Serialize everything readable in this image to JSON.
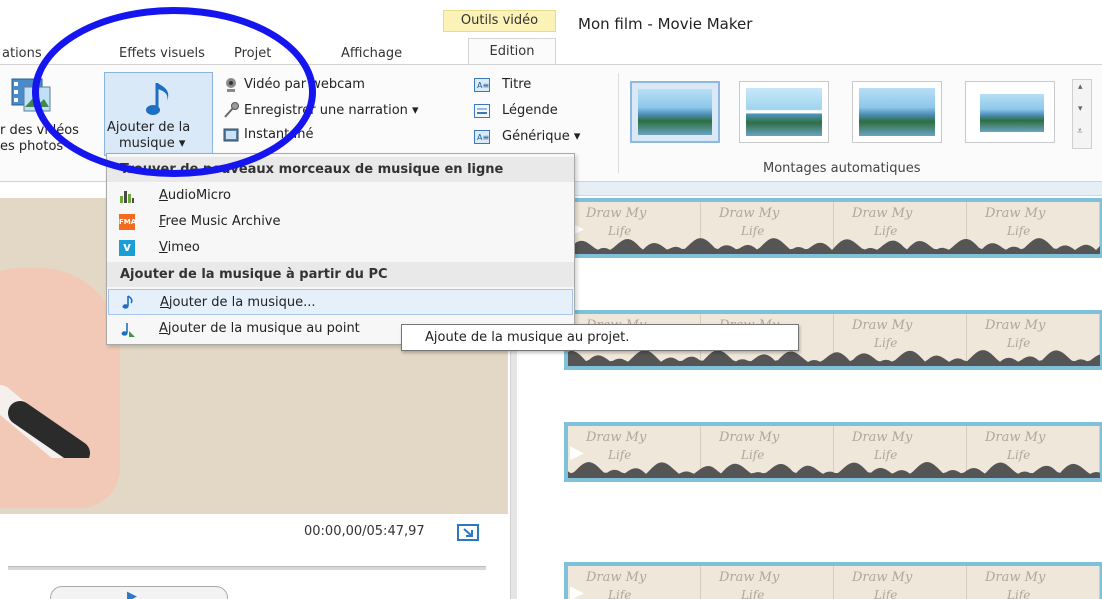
{
  "window": {
    "title": "Mon film - Movie Maker"
  },
  "tabs": {
    "animations": "ations",
    "visual_effects": "Effets visuels",
    "project": "Projet",
    "view": "Affichage",
    "context_group": "Outils vidéo",
    "edit": "Edition"
  },
  "ribbon": {
    "add_videos_line1": "r des vidéos",
    "add_videos_line2": "es photos",
    "add_music_line1": "Ajouter de la",
    "add_music_line2": "musique ▾",
    "webcam": "Vidéo par webcam",
    "narration": "Enregistrer une narration ▾",
    "snapshot": "Instantané",
    "title": "Titre",
    "caption": "Légende",
    "credits": "Générique ▾",
    "automovie_group": "Montages automatiques"
  },
  "menu": {
    "online_header": "Trouver de nouveaux morceaux de musique en ligne",
    "online_items": [
      {
        "label": "AudioMicro",
        "icon": "audiomicro-icon"
      },
      {
        "label": "Free Music Archive",
        "icon": "fma-icon"
      },
      {
        "label": "Vimeo",
        "icon": "vimeo-icon"
      }
    ],
    "pc_header": "Ajouter de la musique à partir du PC",
    "pc_items": [
      {
        "label": "Ajouter de la musique...",
        "icon": "music-note-icon"
      },
      {
        "label": "Ajouter de la musique au point",
        "icon": "music-add-icon"
      }
    ],
    "fma_badge": "FMA",
    "vimeo_badge": "v"
  },
  "tooltip": {
    "text": "Ajoute de la musique au projet."
  },
  "preview": {
    "time": "00:00,00/05:47,97"
  },
  "storyboard": {
    "frame_title_1": "Draw My",
    "frame_title_2": "Life"
  },
  "colors": {
    "accent": "#2b78c6",
    "annotation": "#1515f0",
    "clip_border": "#7fc1da",
    "context_tab": "#fbf2b8"
  }
}
